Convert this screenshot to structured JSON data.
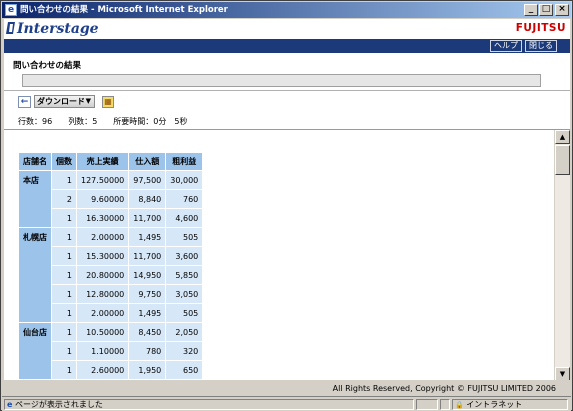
{
  "window": {
    "title": "問い合わせの結果 - Microsoft Internet Explorer",
    "ie_icon": "e",
    "minimize": "_",
    "maximize": "□",
    "close": "×"
  },
  "header": {
    "brand": "Interstage",
    "logo": "FUJITSU",
    "help_button": "ヘルプ",
    "close_button": "閉じる"
  },
  "page": {
    "title": "問い合わせの結果",
    "title_box_value": ""
  },
  "toolbar": {
    "back_icon": "←",
    "download_label": "ダウンロード",
    "download_caret": "▼",
    "export_icon": "▦"
  },
  "stats": {
    "rows_label": "行数：",
    "rows_value": "96",
    "cols_label": "列数：",
    "cols_value": "5",
    "time_label": "所要時間：",
    "time_value": "0分　5秒"
  },
  "table": {
    "headers": [
      "店舗名",
      "個数",
      "売上実績",
      "仕入額",
      "粗利益"
    ],
    "groups": [
      {
        "store": "本店",
        "rows": [
          [
            "1",
            "127.50000",
            "97,500",
            "30,000"
          ],
          [
            "2",
            "9.60000",
            "8,840",
            "760"
          ],
          [
            "1",
            "16.30000",
            "11,700",
            "4,600"
          ]
        ]
      },
      {
        "store": "札幌店",
        "rows": [
          [
            "1",
            "2.00000",
            "1,495",
            "505"
          ],
          [
            "1",
            "15.30000",
            "11,700",
            "3,600"
          ],
          [
            "1",
            "20.80000",
            "14,950",
            "5,850"
          ],
          [
            "1",
            "12.80000",
            "9,750",
            "3,050"
          ],
          [
            "1",
            "2.00000",
            "1,495",
            "505"
          ]
        ]
      },
      {
        "store": "仙台店",
        "rows": [
          [
            "1",
            "10.50000",
            "8,450",
            "2,050"
          ],
          [
            "1",
            "1.10000",
            "780",
            "320"
          ],
          [
            "1",
            "2.60000",
            "1,950",
            "650"
          ]
        ]
      }
    ]
  },
  "scrollbar": {
    "up": "▲",
    "down": "▼"
  },
  "footer": {
    "copyright": "All Rights Reserved, Copyright © FUJITSU LIMITED 2006"
  },
  "statusbar": {
    "page_icon": "e",
    "message": "ページが表示されました",
    "lock_icon": "🔒",
    "zone": "イントラネット"
  },
  "colors": {
    "header_blue": "#1c3a7a",
    "table_header": "#9cc3ea",
    "table_cell": "#d6e7f7",
    "logo_red": "#cc0000"
  }
}
